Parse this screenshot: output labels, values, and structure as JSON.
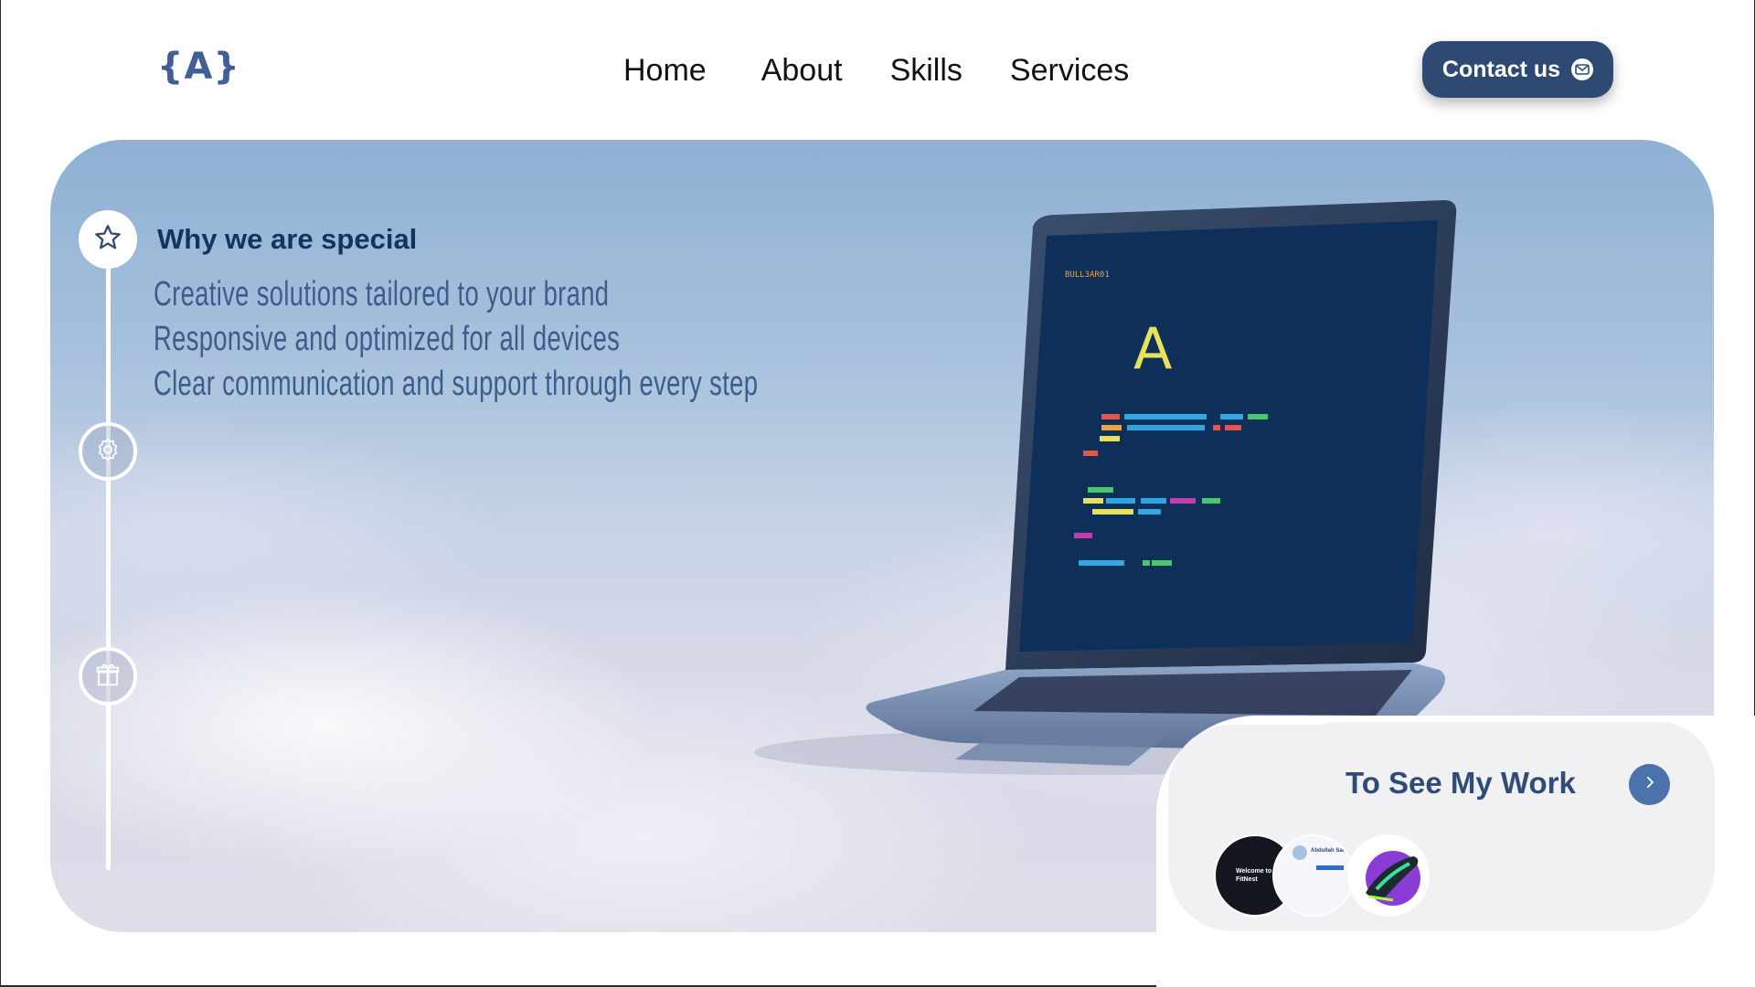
{
  "header": {
    "logo": "{A}",
    "nav": [
      "Home",
      "About",
      "Skills",
      "Services"
    ],
    "contact_label": "Contact us"
  },
  "hero": {
    "section_title": "Why we are special",
    "points": [
      "Creative solutions tailored to your brand",
      "Responsive and optimized for all devices",
      "Clear communication and support through every step"
    ],
    "timeline_icons": [
      "star-icon",
      "gear-icon",
      "gift-icon"
    ]
  },
  "work": {
    "title": "To See My Work",
    "thumbs": [
      {
        "icon": "fitnest-thumbnail",
        "text": "Welcome to FitNest"
      },
      {
        "icon": "portfolio-thumbnail",
        "text": "Abdullah Sarraf"
      },
      {
        "icon": "sneaker-thumbnail",
        "text": ""
      }
    ]
  },
  "colors": {
    "brand": "#2e4a72",
    "accent": "#4b73ab",
    "title": "#13345e",
    "text": "#3c5c8c"
  }
}
